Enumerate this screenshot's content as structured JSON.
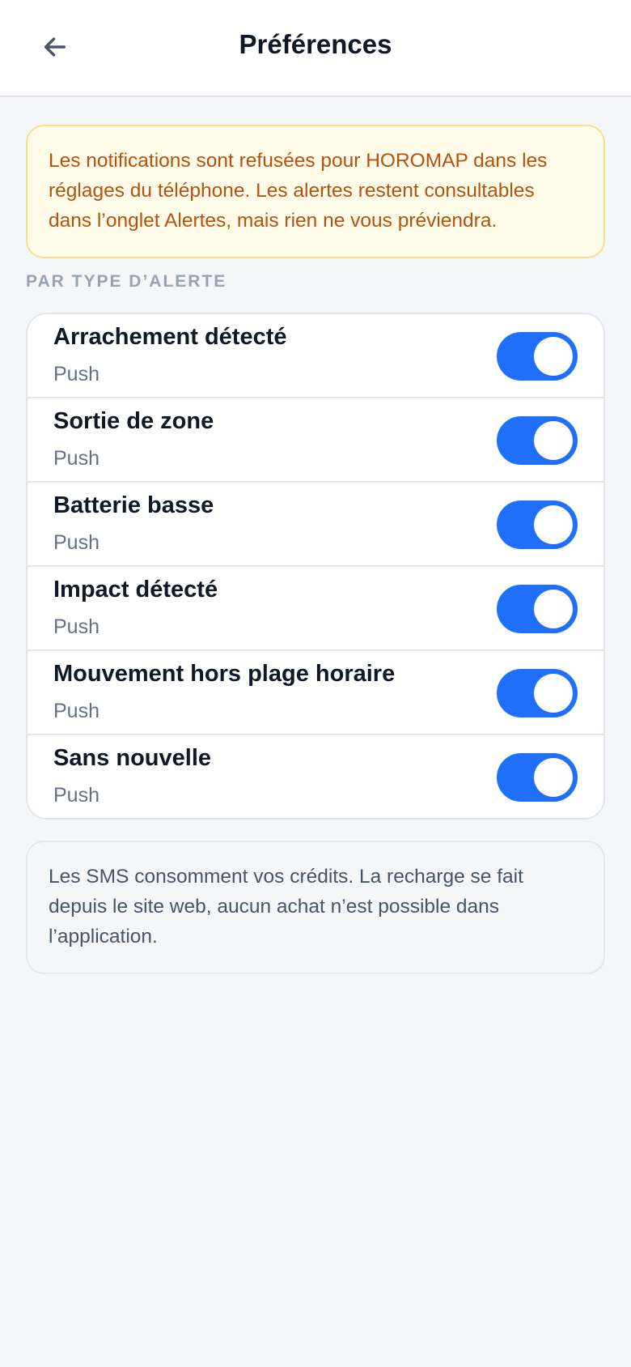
{
  "header": {
    "title": "Préférences",
    "back_icon": "arrow-left-icon"
  },
  "warning": {
    "text": "Les notifications sont refusées pour HOROMAP dans les réglages du téléphone. Les alertes restent consultables dans l’onglet Alertes, mais rien ne vous préviendra."
  },
  "section": {
    "label": "PAR TYPE D’ALERTE"
  },
  "alerts": [
    {
      "title": "Arrachement détecté",
      "channel": "Push",
      "enabled": true
    },
    {
      "title": "Sortie de zone",
      "channel": "Push",
      "enabled": true
    },
    {
      "title": "Batterie basse",
      "channel": "Push",
      "enabled": true
    },
    {
      "title": "Impact détecté",
      "channel": "Push",
      "enabled": true
    },
    {
      "title": "Mouvement hors plage horaire",
      "channel": "Push",
      "enabled": true
    },
    {
      "title": "Sans nouvelle",
      "channel": "Push",
      "enabled": true
    }
  ],
  "info": {
    "text": "Les SMS consomment vos crédits. La recharge se fait depuis le site web, aucun achat n’est possible dans l’application."
  },
  "colors": {
    "accent": "#1f6ffb",
    "warning_bg": "#fefbe8",
    "warning_text": "#b6520f"
  }
}
